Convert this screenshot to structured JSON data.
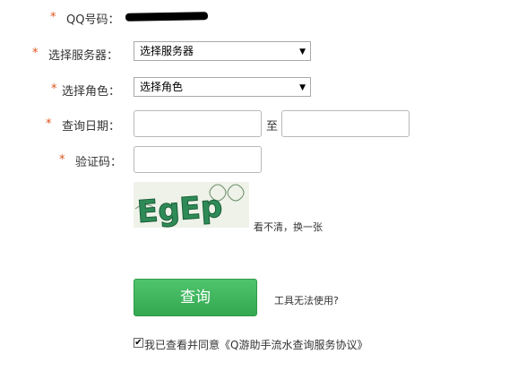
{
  "form": {
    "qq_label": "QQ号码：",
    "server_label": "选择服务器：",
    "server_select": {
      "selected": "选择服务器"
    },
    "role_label": "选择角色：",
    "role_select": {
      "selected": "选择角色"
    },
    "date_label": "查询日期：",
    "date_separator": "至",
    "captcha_label": "验证码：",
    "captcha_text": "EgEp",
    "refresh_link": "看不清，换一张",
    "submit_label": "查询",
    "help_link": "工具无法使用?",
    "agree_text": "我已查看并同意",
    "agreement_link": "《Q游助手流水查询服务协议》",
    "required_mark": "*"
  },
  "colors": {
    "required": "#e0531c",
    "button": "#3cb55a"
  }
}
